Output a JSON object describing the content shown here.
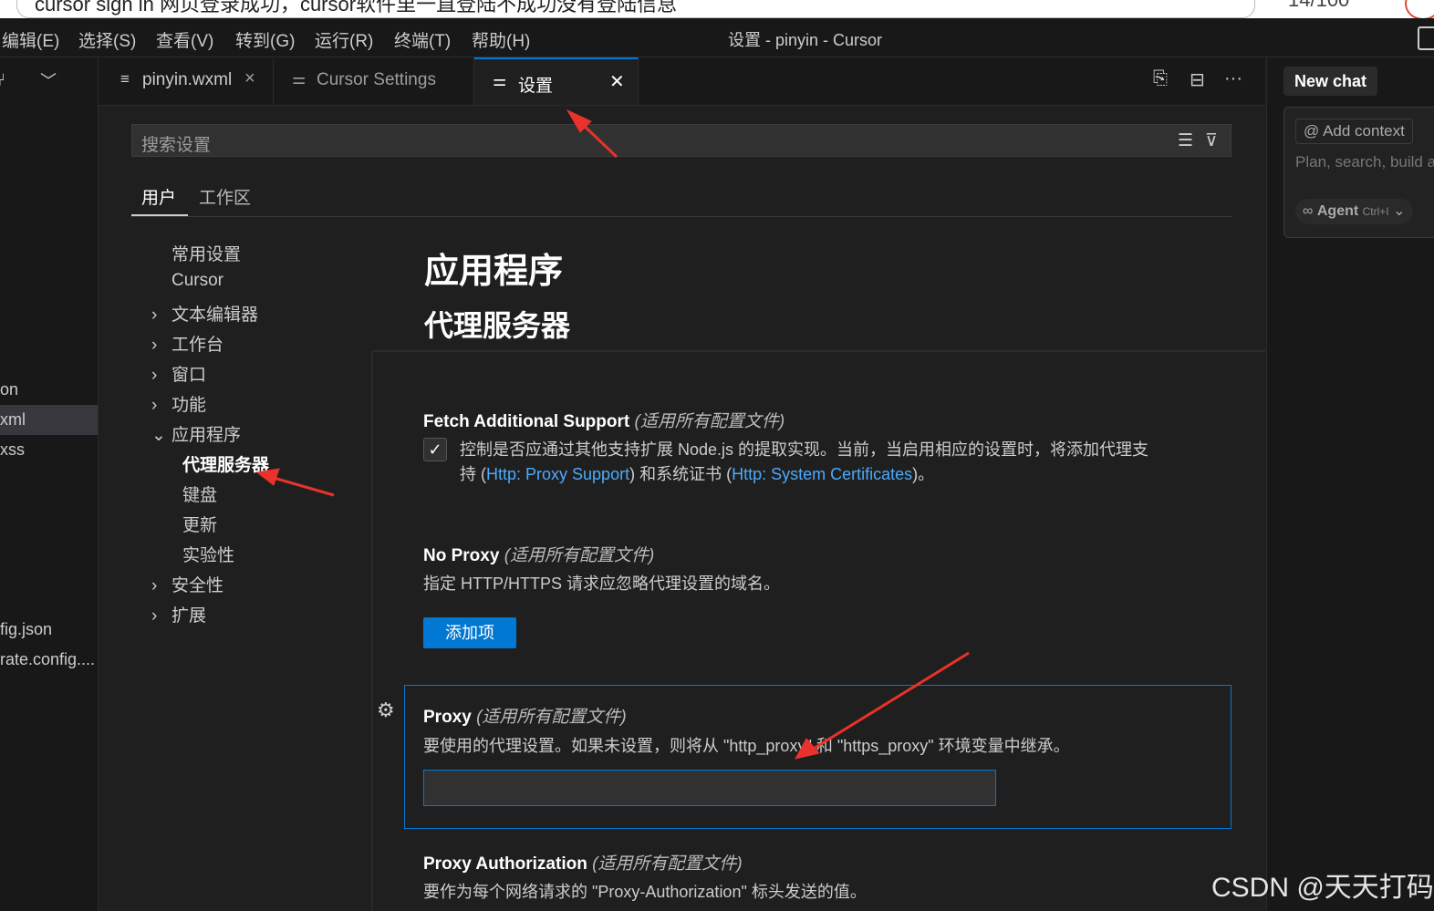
{
  "browser": {
    "tab_text": "cursor sign in 网页登录成功，cursor软件里一直登陆不成功没有登陆信息",
    "counter": "14/100"
  },
  "menu": {
    "items": [
      "编辑(E)",
      "选择(S)",
      "查看(V)",
      "转到(G)",
      "运行(R)",
      "终端(T)",
      "帮助(H)"
    ],
    "window_title": "设置 - pinyin - Cursor"
  },
  "explorer": {
    "items": [
      "on",
      "xml",
      "xss",
      "fig.json",
      "rate.config...."
    ]
  },
  "tabs": {
    "tab1": "pinyin.wxml",
    "tab2": "Cursor Settings",
    "tab3": "设置"
  },
  "settings": {
    "search_placeholder": "搜索设置",
    "scope_user": "用户",
    "scope_workspace": "工作区",
    "toc": [
      "常用设置",
      "Cursor",
      "文本编辑器",
      "工作台",
      "窗口",
      "功能",
      "应用程序",
      "代理服务器",
      "键盘",
      "更新",
      "实验性",
      "安全性",
      "扩展"
    ],
    "section_title": "应用程序",
    "subsection_title": "代理服务器",
    "scope_note": "(适用所有配置文件)",
    "fetch": {
      "title": "Fetch Additional Support",
      "desc_1": "控制是否应通过其他支持扩展 Node.js 的提取实现。当前，当启用相应的设置时，将添加代理支",
      "desc_2a": "持 (",
      "link_1": "Http: Proxy Support",
      "desc_2b": ") 和系统证书 (",
      "link_2": "Http: System Certificates",
      "desc_2c": ")。"
    },
    "no_proxy": {
      "title": "No Proxy",
      "desc": "指定 HTTP/HTTPS 请求应忽略代理设置的域名。",
      "button": "添加项"
    },
    "proxy": {
      "title": "Proxy",
      "desc": "要使用的代理设置。如果未设置，则将从 \"http_proxy\" 和 \"https_proxy\" 环境变量中继承。",
      "value": ""
    },
    "proxy_auth": {
      "title": "Proxy Authorization",
      "desc": "要作为每个网络请求的 \"Proxy-Authorization\" 标头发送的值。"
    }
  },
  "chat": {
    "new_chat": "New chat",
    "add_context": "Add context",
    "placeholder": "Plan, search, build a",
    "agent": "Agent",
    "agent_shortcut": "Ctrl+I"
  },
  "watermark": "CSDN @天天打码",
  "colors": {
    "accent": "#0078d4",
    "link": "#4daafc",
    "annotation_arrow": "#e8322b"
  }
}
